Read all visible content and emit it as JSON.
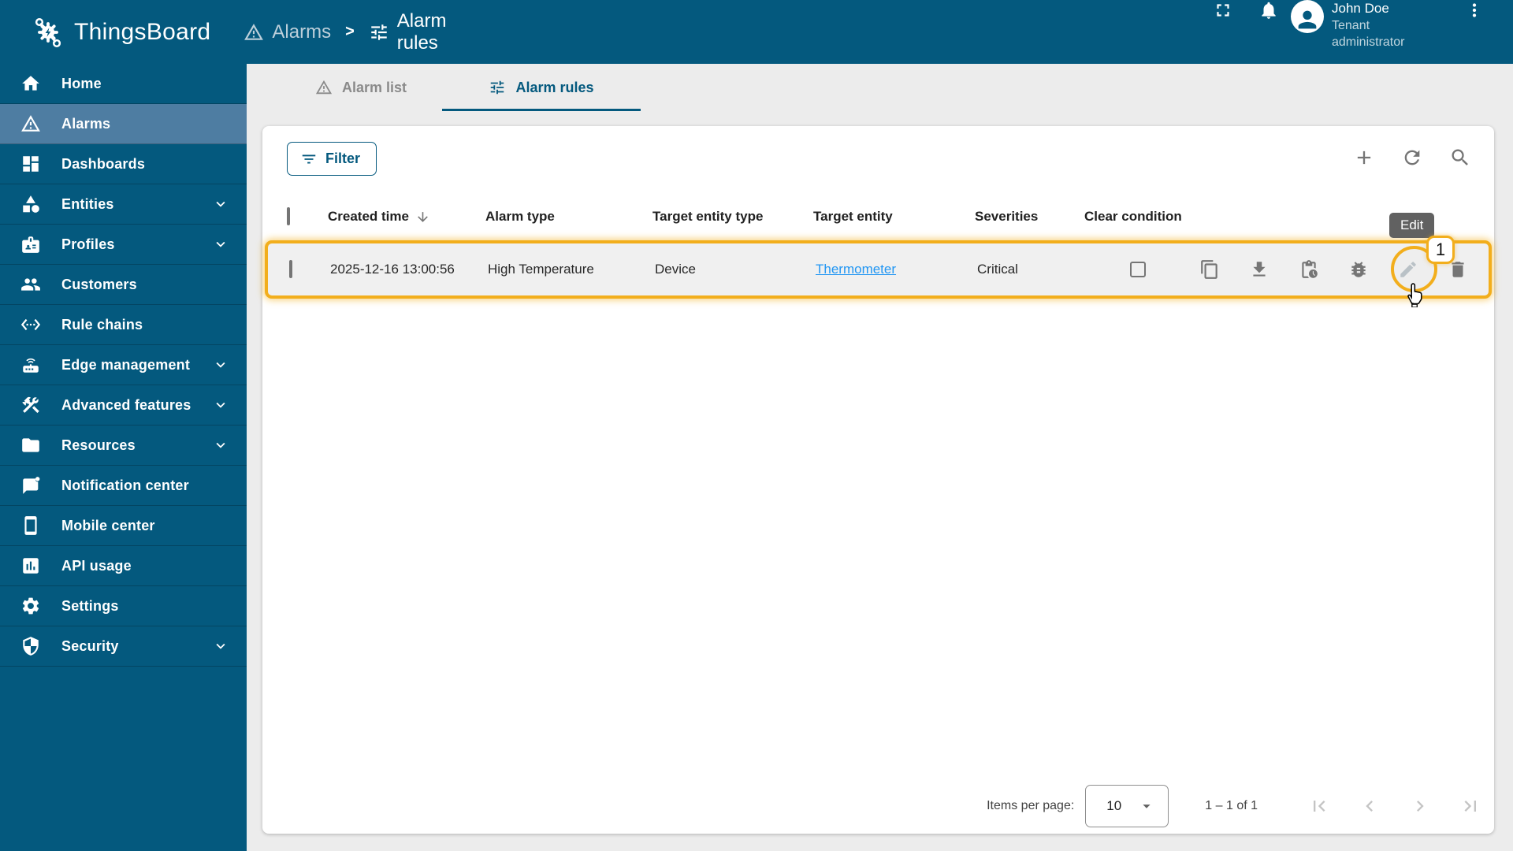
{
  "app": {
    "name": "ThingsBoard"
  },
  "header": {
    "breadcrumb": {
      "section": "Alarms",
      "separator": ">",
      "page": "Alarm rules"
    },
    "user": {
      "name": "John Doe",
      "role": "Tenant administrator"
    }
  },
  "sidebar": {
    "items": [
      {
        "label": "Home"
      },
      {
        "label": "Alarms",
        "active": true
      },
      {
        "label": "Dashboards"
      },
      {
        "label": "Entities",
        "expandable": true
      },
      {
        "label": "Profiles",
        "expandable": true
      },
      {
        "label": "Customers"
      },
      {
        "label": "Rule chains"
      },
      {
        "label": "Edge management",
        "expandable": true
      },
      {
        "label": "Advanced features",
        "expandable": true
      },
      {
        "label": "Resources",
        "expandable": true
      },
      {
        "label": "Notification center"
      },
      {
        "label": "Mobile center"
      },
      {
        "label": "API usage"
      },
      {
        "label": "Settings"
      },
      {
        "label": "Security",
        "expandable": true
      }
    ]
  },
  "tabs": {
    "alarm_list": "Alarm list",
    "alarm_rules": "Alarm rules"
  },
  "toolbar": {
    "filter_label": "Filter"
  },
  "table": {
    "headers": {
      "created_time": "Created time",
      "alarm_type": "Alarm type",
      "target_entity_type": "Target entity type",
      "target_entity": "Target entity",
      "severities": "Severities",
      "clear_condition": "Clear condition"
    },
    "row": {
      "created_time": "2025-12-16 13:00:56",
      "alarm_type": "High Temperature",
      "target_entity_type": "Device",
      "target_entity": "Thermometer",
      "severities": "Critical"
    }
  },
  "annotations": {
    "tooltip": "Edit",
    "step_badge": "1"
  },
  "pagination": {
    "items_per_page_label": "Items per page:",
    "page_size": "10",
    "range": "1 – 1 of 1"
  },
  "colors": {
    "header_bg": "#04597e",
    "sidebar_active_bg": "#4e7da2",
    "highlight_accent": "#f2ae1c",
    "link": "#2196f3",
    "tab_active": "#04597e",
    "icon_gray": "#757575",
    "tooltip_bg": "#616161"
  }
}
